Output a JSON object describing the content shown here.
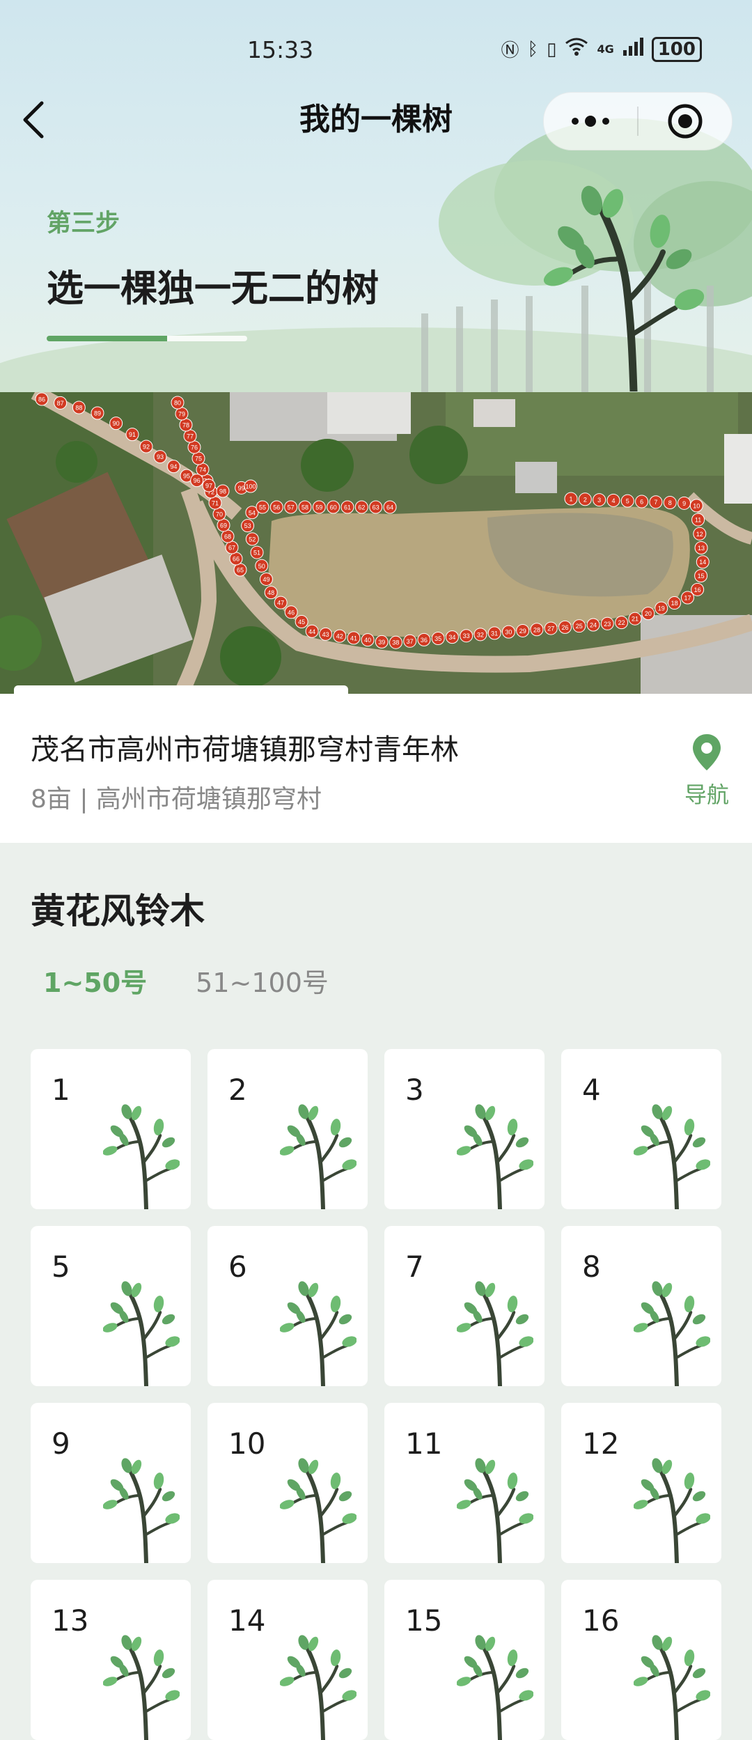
{
  "status": {
    "time": "15:33",
    "network": "4G",
    "battery": "100"
  },
  "nav": {
    "title": "我的一棵树"
  },
  "step": {
    "label": "第三步",
    "title": "选一棵独一无二的树",
    "progress": 0.6
  },
  "map": {
    "markers": [
      "1",
      "2",
      "3",
      "4",
      "5",
      "6",
      "7",
      "8",
      "9",
      "10",
      "11",
      "12",
      "13",
      "14",
      "15",
      "16",
      "17",
      "18",
      "19",
      "20",
      "21",
      "22",
      "23",
      "24",
      "25",
      "26",
      "27",
      "28",
      "29",
      "30",
      "31",
      "32",
      "33",
      "34",
      "35",
      "36",
      "37",
      "38",
      "39",
      "40",
      "41",
      "42",
      "43",
      "44",
      "45",
      "46",
      "47",
      "48",
      "49",
      "50",
      "51",
      "52",
      "53",
      "54",
      "55",
      "56",
      "57",
      "58",
      "59",
      "60",
      "61",
      "62",
      "63",
      "64",
      "65",
      "66",
      "67",
      "68",
      "69",
      "70",
      "71",
      "72",
      "73",
      "74",
      "75",
      "76",
      "77",
      "78",
      "79",
      "80",
      "86",
      "87",
      "88",
      "89",
      "90",
      "91",
      "92",
      "93",
      "94",
      "95",
      "96",
      "97",
      "98",
      "99",
      "100"
    ]
  },
  "location": {
    "name": "茂名市高州市荷塘镇那穹村青年林",
    "detail": "8亩 | 高州市荷塘镇那穹村",
    "navigate_label": "导航"
  },
  "species": {
    "name": "黄花风铃木",
    "tabs": [
      {
        "label": "1~50号",
        "active": true
      },
      {
        "label": "51~100号",
        "active": false
      }
    ],
    "trees": [
      "1",
      "2",
      "3",
      "4",
      "5",
      "6",
      "7",
      "8",
      "9",
      "10",
      "11",
      "12",
      "13",
      "14",
      "15",
      "16"
    ]
  },
  "colors": {
    "accent": "#5fa564",
    "marker": "#d23a22"
  }
}
